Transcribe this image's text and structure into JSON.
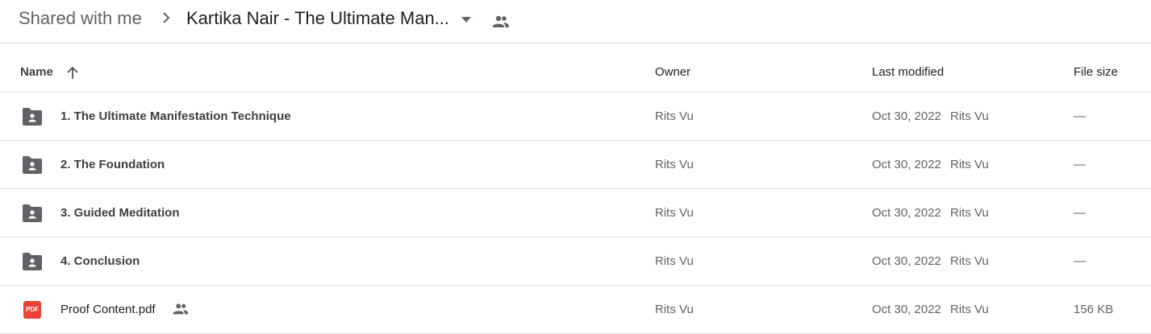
{
  "breadcrumb": {
    "root": "Shared with me",
    "current": "Kartika Nair - The Ultimate Man..."
  },
  "columns": {
    "name": "Name",
    "owner": "Owner",
    "last_modified": "Last modified",
    "file_size": "File size"
  },
  "rows": [
    {
      "name": "1. The Ultimate Manifestation Technique",
      "type": "shared-folder",
      "owner": "Rits Vu",
      "modified_date": "Oct 30, 2022",
      "modified_by": "Rits Vu",
      "size": "—"
    },
    {
      "name": "2. The Foundation",
      "type": "shared-folder",
      "owner": "Rits Vu",
      "modified_date": "Oct 30, 2022",
      "modified_by": "Rits Vu",
      "size": "—"
    },
    {
      "name": "3. Guided Meditation",
      "type": "shared-folder",
      "owner": "Rits Vu",
      "modified_date": "Oct 30, 2022",
      "modified_by": "Rits Vu",
      "size": "—"
    },
    {
      "name": "4. Conclusion",
      "type": "shared-folder",
      "owner": "Rits Vu",
      "modified_date": "Oct 30, 2022",
      "modified_by": "Rits Vu",
      "size": "—"
    },
    {
      "name": "Proof Content.pdf",
      "type": "pdf",
      "pdf_label": "PDF",
      "owner": "Rits Vu",
      "modified_date": "Oct 30, 2022",
      "modified_by": "Rits Vu",
      "size": "156 KB"
    }
  ],
  "colors": {
    "folder_icon": "#5f6368",
    "pdf_icon": "#ea4335",
    "divider": "#dadce0"
  }
}
